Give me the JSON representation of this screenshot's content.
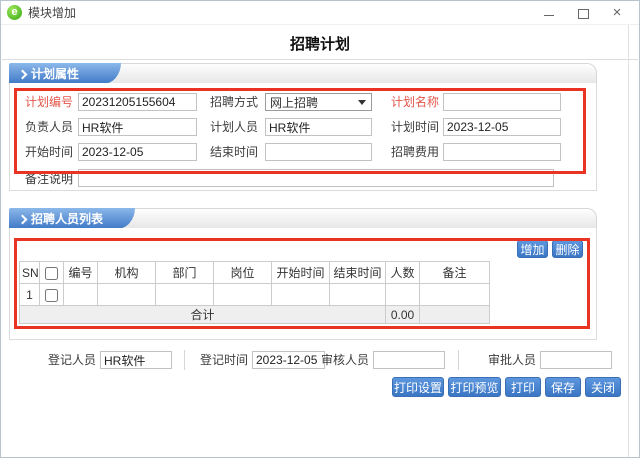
{
  "window": {
    "title": "模块增加",
    "close_glyph": "×"
  },
  "page": {
    "title": "招聘计划"
  },
  "colors": {
    "tab_blue": "#3e78c6",
    "button_blue": "#4a86d0",
    "annotation_red": "#ea3423",
    "required_label_red": "#e2574b"
  },
  "plan": {
    "header": "计划属性",
    "fields": {
      "plan_no": {
        "label": "计划编号",
        "value": "20231205155604"
      },
      "method": {
        "label": "招聘方式",
        "value": "网上招聘"
      },
      "plan_name": {
        "label": "计划名称",
        "value": ""
      },
      "owner": {
        "label": "负责人员",
        "value": "HR软件"
      },
      "planner": {
        "label": "计划人员",
        "value": "HR软件"
      },
      "plan_date": {
        "label": "计划时间",
        "value": "2023-12-05"
      },
      "start_date": {
        "label": "开始时间",
        "value": "2023-12-05"
      },
      "end_date": {
        "label": "结束时间",
        "value": ""
      },
      "cost": {
        "label": "招聘费用",
        "value": ""
      },
      "remark": {
        "label": "备注说明",
        "value": ""
      }
    }
  },
  "list": {
    "header": "招聘人员列表",
    "add_button": "增加",
    "delete_button": "删除",
    "table": {
      "columns": [
        "SN",
        "编号",
        "机构",
        "部门",
        "岗位",
        "开始时间",
        "结束时间",
        "人数",
        "备注"
      ],
      "rows": [
        {
          "sn": "1",
          "cells": [
            "",
            "",
            "",
            "",
            "",
            "",
            "",
            ""
          ]
        }
      ],
      "footer": {
        "label": "合计",
        "total": "0.00"
      }
    }
  },
  "footer": {
    "fields": {
      "reg_person": {
        "label": "登记人员",
        "value": "HR软件"
      },
      "reg_time": {
        "label": "登记时间",
        "value": "2023-12-05"
      },
      "auditor": {
        "label": "审核人员",
        "value": ""
      },
      "approver": {
        "label": "审批人员",
        "value": ""
      }
    },
    "actions": [
      "打印设置",
      "打印预览",
      "打印",
      "保存",
      "关闭"
    ]
  }
}
